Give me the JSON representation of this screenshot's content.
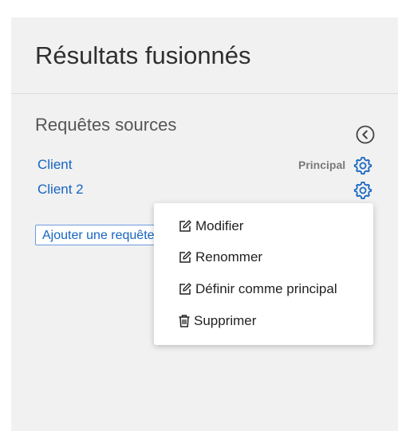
{
  "header": {
    "title": "Résultats fusionnés"
  },
  "sources": {
    "title": "Requêtes sources",
    "collapse_icon": "chevron-left-circle-icon",
    "queries": [
      {
        "label": "Client",
        "badge": "Principal"
      },
      {
        "label": "Client 2"
      }
    ],
    "add_label": "Ajouter une requête"
  },
  "context_menu": {
    "items": [
      {
        "label": "Modifier",
        "icon": "edit-icon"
      },
      {
        "label": "Renommer",
        "icon": "edit-icon"
      },
      {
        "label": "Définir comme principal",
        "icon": "edit-icon"
      },
      {
        "label": "Supprimer",
        "icon": "trash-icon"
      }
    ]
  },
  "colors": {
    "link": "#1565c0",
    "panel_bg": "#f1f1f1"
  }
}
